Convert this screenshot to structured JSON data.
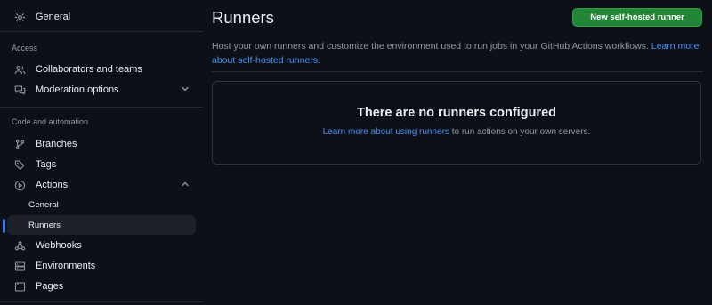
{
  "sidebar": {
    "general": "General",
    "access_heading": "Access",
    "collaborators": "Collaborators and teams",
    "moderation": "Moderation options",
    "code_heading": "Code and automation",
    "branches": "Branches",
    "tags": "Tags",
    "actions": "Actions",
    "actions_general": "General",
    "actions_runners": "Runners",
    "webhooks": "Webhooks",
    "environments": "Environments",
    "pages": "Pages"
  },
  "main": {
    "title": "Runners",
    "new_button": "New self-hosted runner",
    "description": "Host your own runners and customize the environment used to run jobs in your GitHub Actions workflows.",
    "description_link": "Learn more about self-hosted runners",
    "description_end": ".",
    "empty_title": "There are no runners configured",
    "empty_link": "Learn more about using runners",
    "empty_text": " to run actions on your own servers."
  },
  "colors": {
    "background": "#0d1117",
    "accent": "#2f81f7",
    "link": "#4493f8",
    "button": "#238636"
  }
}
